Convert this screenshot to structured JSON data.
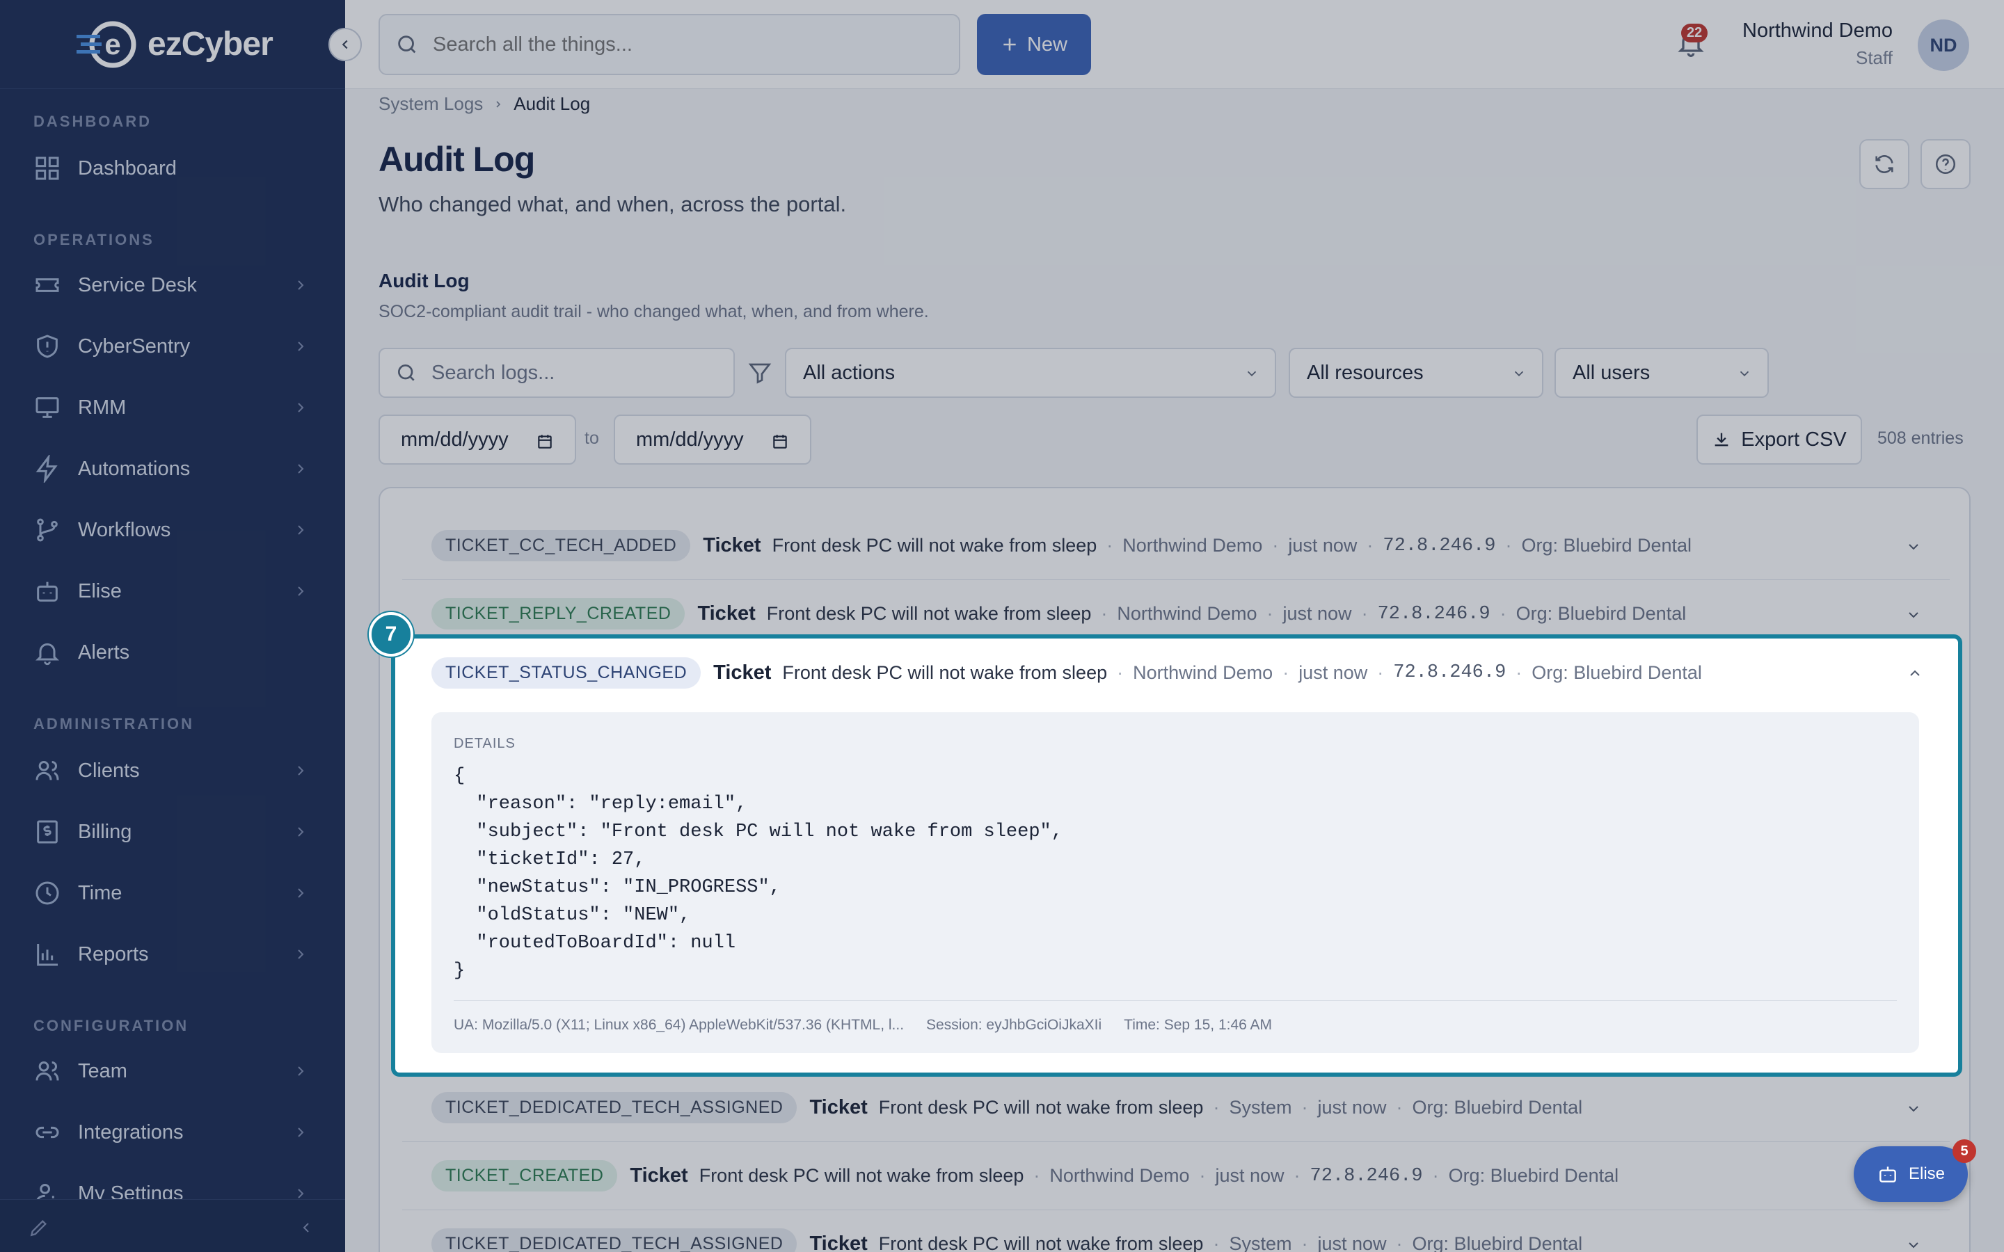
{
  "app": {
    "logo_e": "e",
    "logo_name": "ezCyber"
  },
  "sidebar": {
    "sections": [
      "DASHBOARD",
      "OPERATIONS",
      "ADMINISTRATION",
      "CONFIGURATION"
    ],
    "items": [
      {
        "label": "Dashboard"
      },
      {
        "label": "Service Desk"
      },
      {
        "label": "CyberSentry"
      },
      {
        "label": "RMM"
      },
      {
        "label": "Automations"
      },
      {
        "label": "Workflows"
      },
      {
        "label": "Elise"
      },
      {
        "label": "Alerts"
      },
      {
        "label": "Clients"
      },
      {
        "label": "Billing"
      },
      {
        "label": "Time"
      },
      {
        "label": "Reports"
      },
      {
        "label": "Team"
      },
      {
        "label": "Integrations"
      },
      {
        "label": "My Settings"
      }
    ]
  },
  "topbar": {
    "search_placeholder": "Search all the things...",
    "new_label": "New",
    "notifications_count": "22",
    "user_name": "Northwind Demo",
    "user_role": "Staff",
    "user_initials": "ND"
  },
  "breadcrumb": {
    "parent": "System Logs",
    "current": "Audit Log"
  },
  "page": {
    "title": "Audit Log",
    "subtitle": "Who changed what, and when, across the portal."
  },
  "section": {
    "title": "Audit Log",
    "subtitle": "SOC2-compliant audit trail - who changed what, when, and from where."
  },
  "filters": {
    "search_placeholder": "Search logs...",
    "actions": "All actions",
    "resources": "All resources",
    "users": "All users",
    "date_placeholder": "mm/dd/yyyy",
    "to": "to",
    "export_label": "Export CSV",
    "entries": "508 entries"
  },
  "logs": [
    {
      "action": "TICKET_CC_TECH_ADDED",
      "resource": "Ticket",
      "subject": "Front desk PC will not wake from sleep",
      "user": "Northwind Demo",
      "time": "just now",
      "ip": "72.8.246.9",
      "org": "Org: Bluebird Dental"
    },
    {
      "action": "TICKET_REPLY_CREATED",
      "resource": "Ticket",
      "subject": "Front desk PC will not wake from sleep",
      "user": "Northwind Demo",
      "time": "just now",
      "ip": "72.8.246.9",
      "org": "Org: Bluebird Dental"
    },
    {
      "action": "TICKET_STATUS_CHANGED",
      "resource": "Ticket",
      "subject": "Front desk PC will not wake from sleep",
      "user": "Northwind Demo",
      "time": "just now",
      "ip": "72.8.246.9",
      "org": "Org: Bluebird Dental"
    },
    {
      "action": "TICKET_DEDICATED_TECH_ASSIGNED",
      "resource": "Ticket",
      "subject": "Front desk PC will not wake from sleep",
      "user": "System",
      "time": "just now",
      "ip": "",
      "org": "Org: Bluebird Dental"
    },
    {
      "action": "TICKET_CREATED",
      "resource": "Ticket",
      "subject": "Front desk PC will not wake from sleep",
      "user": "Northwind Demo",
      "time": "just now",
      "ip": "72.8.246.9",
      "org": "Org: Bluebird Dental"
    },
    {
      "action": "TICKET_DEDICATED_TECH_ASSIGNED",
      "resource": "Ticket",
      "subject": "Front desk PC will not wake from sleep",
      "user": "System",
      "time": "just now",
      "ip": "",
      "org": "Org: Bluebird Dental"
    }
  ],
  "details": {
    "label": "DETAILS",
    "json": "{\n  \"reason\": \"reply:email\",\n  \"subject\": \"Front desk PC will not wake from sleep\",\n  \"ticketId\": 27,\n  \"newStatus\": \"IN_PROGRESS\",\n  \"oldStatus\": \"NEW\",\n  \"routedToBoardId\": null\n}",
    "ua": "UA: Mozilla/5.0 (X11; Linux x86_64) AppleWebKit/537.36 (KHTML, l...",
    "session": "Session: eyJhbGciOiJkaXIi",
    "time": "Time: Sep 15, 1:46 AM"
  },
  "step_marker": "7",
  "elise_widget": {
    "label": "Elise",
    "count": "5"
  }
}
